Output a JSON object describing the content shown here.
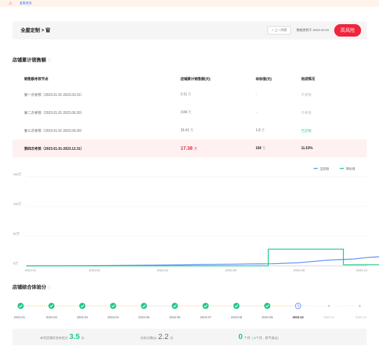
{
  "banner": {
    "text_1": "",
    "text_2": "",
    "more": "查看更多"
  },
  "header": {
    "title": "全屋定制 > 窗",
    "subtitle": "",
    "prev_button": "< 上一周期",
    "data_date": "数据更新于 2023-10-23",
    "risk_button": "高风险"
  },
  "sales_section": {
    "title": "店铺累计销售额",
    "columns": [
      "销售额考核节点",
      "店铺累计销售额(元)",
      "目标值(元)",
      "完成情况"
    ],
    "rows": [
      {
        "node": "第一次考核（2023.01.01-2023.03.31）",
        "amount": "2.11",
        "unit": "万",
        "target": "-",
        "target_unit": "",
        "status": "不考核",
        "highlight": false
      },
      {
        "node": "第二次考核（2023.01.01-2023.06.30）",
        "amount": "3.84",
        "unit": "万",
        "target": "-",
        "target_unit": "",
        "status": "不考核",
        "highlight": false
      },
      {
        "node": "第三次考核（2023.01.01-2023.09.30）",
        "amount": "15.41",
        "unit": "万",
        "target": "1.8",
        "target_unit": "万",
        "status": "已达标",
        "highlight": false
      },
      {
        "node": "第四次考核（2023.01.01-2023.12.31）",
        "amount": "17.38",
        "unit": "万",
        "target": "150",
        "target_unit": "万",
        "status": "11.53%",
        "highlight": true
      }
    ]
  },
  "chart_data": {
    "type": "line",
    "title": "",
    "xlabel": "",
    "ylabel": "",
    "x": [
      "2023.01",
      "2023.03",
      "2023.04",
      "2023.06",
      "2023.08",
      "2023.10"
    ],
    "y_ticks": [
      "0万",
      "50万",
      "100万",
      "150万"
    ],
    "ylim": [
      0,
      150
    ],
    "legend_position": "top-right",
    "grid": true,
    "series": [
      {
        "name": "当前值",
        "color": "#5b8ff9",
        "points": [
          [
            0,
            0
          ],
          [
            1,
            0.4
          ],
          [
            2,
            1.3
          ],
          [
            3,
            2.8
          ],
          [
            3.6,
            3.6
          ],
          [
            4,
            5.2
          ],
          [
            4.4,
            9.4
          ],
          [
            4.8,
            11.5
          ],
          [
            5,
            14.1
          ],
          [
            5.35,
            16.4
          ],
          [
            5.7,
            17.4
          ]
        ]
      },
      {
        "name": "目标值",
        "color": "#1ec78a",
        "points": [
          [
            0,
            0
          ],
          [
            3.55,
            0
          ],
          [
            3.55,
            28
          ],
          [
            4.65,
            28
          ],
          [
            4.65,
            1.8
          ],
          [
            5.23,
            1.8
          ],
          [
            5.23,
            15.8
          ],
          [
            5.46,
            15.8
          ],
          [
            5.46,
            150
          ],
          [
            5.7,
            150
          ]
        ]
      }
    ]
  },
  "score_section": {
    "title": "店铺综合体验分",
    "months": [
      {
        "label": "2023.01",
        "state": "done"
      },
      {
        "label": "2023.02",
        "state": "done"
      },
      {
        "label": "2023.03",
        "state": "done"
      },
      {
        "label": "2023.04",
        "state": "done"
      },
      {
        "label": "2023.05",
        "state": "done"
      },
      {
        "label": "2023.06",
        "state": "done"
      },
      {
        "label": "2023.07",
        "state": "done"
      },
      {
        "label": "2023.08",
        "state": "done"
      },
      {
        "label": "2023.09",
        "state": "done"
      },
      {
        "label": "2023.10",
        "state": "current"
      },
      {
        "label": "2023.11",
        "state": "future"
      },
      {
        "label": "2023.12",
        "state": "future"
      }
    ]
  },
  "bottom": {
    "label_1": "本月店铺综合体验分",
    "value_1": "3.5",
    "unit_1": "分",
    "label_2": "达标分数(≥)",
    "value_2": "2.2",
    "unit_2": "分",
    "label_3": "",
    "value_3": "0",
    "unit_3": "个月",
    "note_prefix": "(",
    "note_value": "0",
    "note_suffix": "个月，即不通过)"
  },
  "colors": {
    "accent_red": "#f0243c",
    "accent_green": "#1ec78a",
    "accent_blue": "#5b8ff9",
    "warning_orange": "#ff7a45"
  }
}
